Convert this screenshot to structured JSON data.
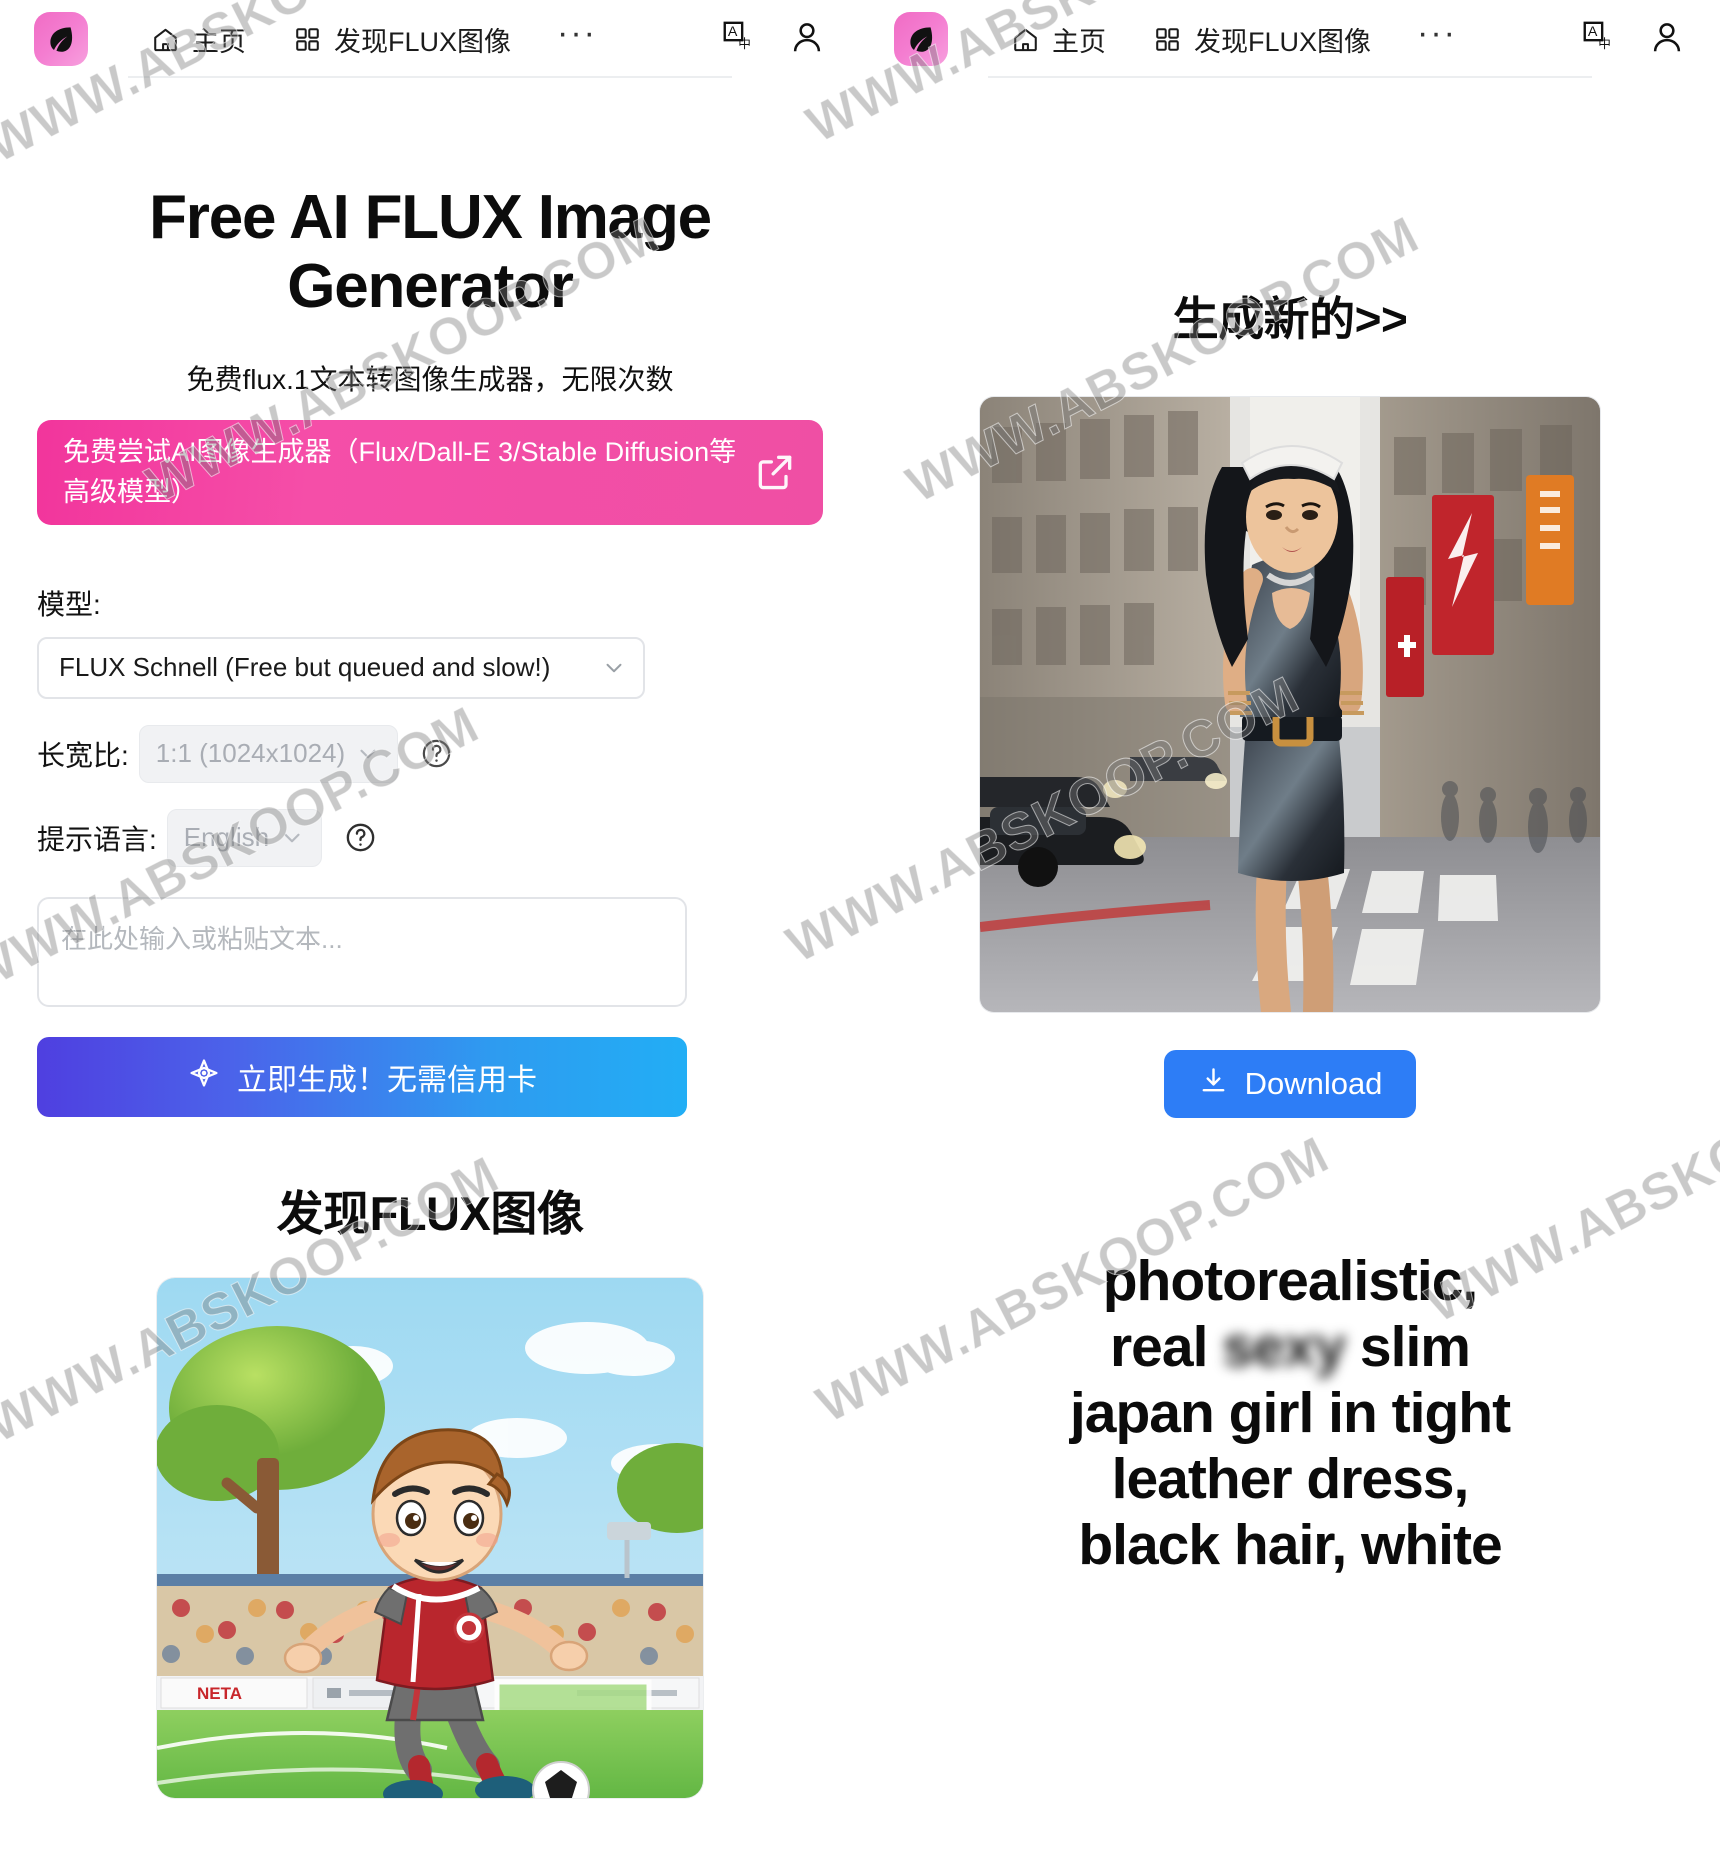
{
  "header": {
    "logo_alt": "leaf-logo",
    "nav": [
      {
        "icon": "home-icon",
        "label": "主页"
      },
      {
        "icon": "grid-icon",
        "label": "发现FLUX图像"
      }
    ],
    "overflow_label": "···",
    "translate_icon": "translate-icon",
    "account_icon": "user-icon"
  },
  "hero": {
    "title": "Free AI FLUX Image Generator",
    "subtitle": "免费flux.1文本转图像生成器，无限次数",
    "cta_text": "免费尝试AI图像生成器（Flux/Dall-E 3/Stable Diffusion等高级模型）",
    "cta_icon": "external-link-icon"
  },
  "form": {
    "model_label": "模型:",
    "model_value": "FLUX Schnell (Free but queued and slow!)",
    "aspect_label": "长宽比:",
    "aspect_value": "1:1 (1024x1024)",
    "aspect_help": "?",
    "language_label": "提示语言:",
    "language_value": "English",
    "language_help": "?",
    "prompt_placeholder": "在此处输入或粘贴文本...",
    "generate_label": "立即生成！无需信用卡",
    "generate_icon": "sparkle-icon"
  },
  "discover": {
    "section_title": "发现FLUX图像",
    "image_alt": "cartoon-boy-playing-soccer-in-stadium",
    "banner_text": "NETA"
  },
  "result": {
    "heading": "生成新的>>",
    "image_alt": "woman-in-black-leather-dress-on-city-street",
    "download_label": "Download",
    "download_icon": "download-icon"
  },
  "prompt_display": {
    "line1": "photorealistic,",
    "line2_before": "real ",
    "line2_redacted": "sexy",
    "line2_after": " slim",
    "line3": "japan girl in tight",
    "line4": "leather dress,",
    "line5": "black hair, white"
  },
  "watermark": {
    "text": "WWW.ABSKOOP.COM",
    "color": "#787878"
  },
  "colors": {
    "brand_pink": "#f2359c",
    "cta_blue": "#2d7df6",
    "generate_gradient_from": "#4f3fe0",
    "generate_gradient_to": "#22aef5"
  }
}
